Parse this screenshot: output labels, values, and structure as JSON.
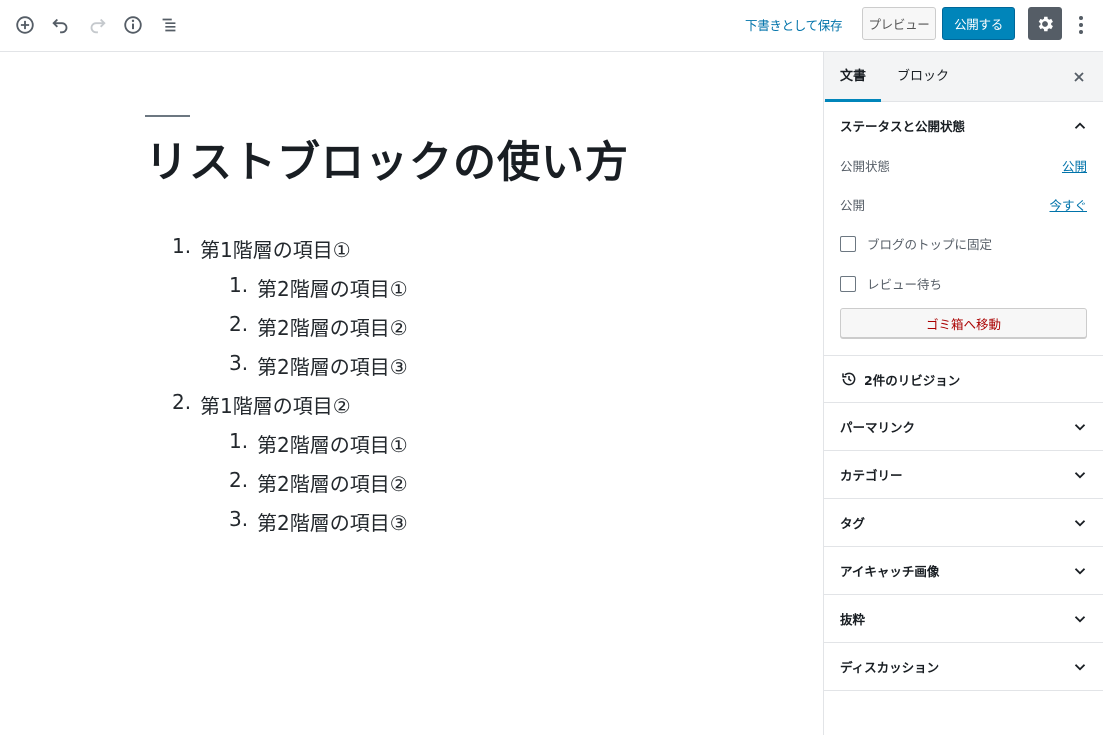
{
  "toolbar": {
    "save_draft_label": "下書きとして保存",
    "preview_label": "プレビュー",
    "publish_label": "公開する"
  },
  "editor": {
    "title": "リストブロックの使い方",
    "list": [
      {
        "num": "1.",
        "text": "第1階層の項目①",
        "level": 1
      },
      {
        "num": "1.",
        "text": "第2階層の項目①",
        "level": 2
      },
      {
        "num": "2.",
        "text": "第2階層の項目②",
        "level": 2
      },
      {
        "num": "3.",
        "text": "第2階層の項目③",
        "level": 2
      },
      {
        "num": "2.",
        "text": "第1階層の項目②",
        "level": 1
      },
      {
        "num": "1.",
        "text": "第2階層の項目①",
        "level": 2
      },
      {
        "num": "2.",
        "text": "第2階層の項目②",
        "level": 2
      },
      {
        "num": "3.",
        "text": "第2階層の項目③",
        "level": 2
      }
    ]
  },
  "sidebar": {
    "tabs": [
      {
        "label": "文書",
        "active": true
      },
      {
        "label": "ブロック",
        "active": false
      }
    ],
    "status_panel": {
      "title": "ステータスと公開状態",
      "visibility_label": "公開状態",
      "visibility_value": "公開",
      "publish_label": "公開",
      "publish_value": "今すぐ",
      "sticky_label": "ブログのトップに固定",
      "pending_label": "レビュー待ち",
      "trash_label": "ゴミ箱へ移動"
    },
    "revisions_label": "2件のリビジョン",
    "panels": [
      {
        "title": "パーマリンク"
      },
      {
        "title": "カテゴリー"
      },
      {
        "title": "タグ"
      },
      {
        "title": "アイキャッチ画像"
      },
      {
        "title": "抜粋"
      },
      {
        "title": "ディスカッション"
      }
    ]
  },
  "colors": {
    "accent": "#0085ba",
    "link": "#0073aa",
    "trash": "#a00000",
    "settings_bg": "#555d66"
  }
}
